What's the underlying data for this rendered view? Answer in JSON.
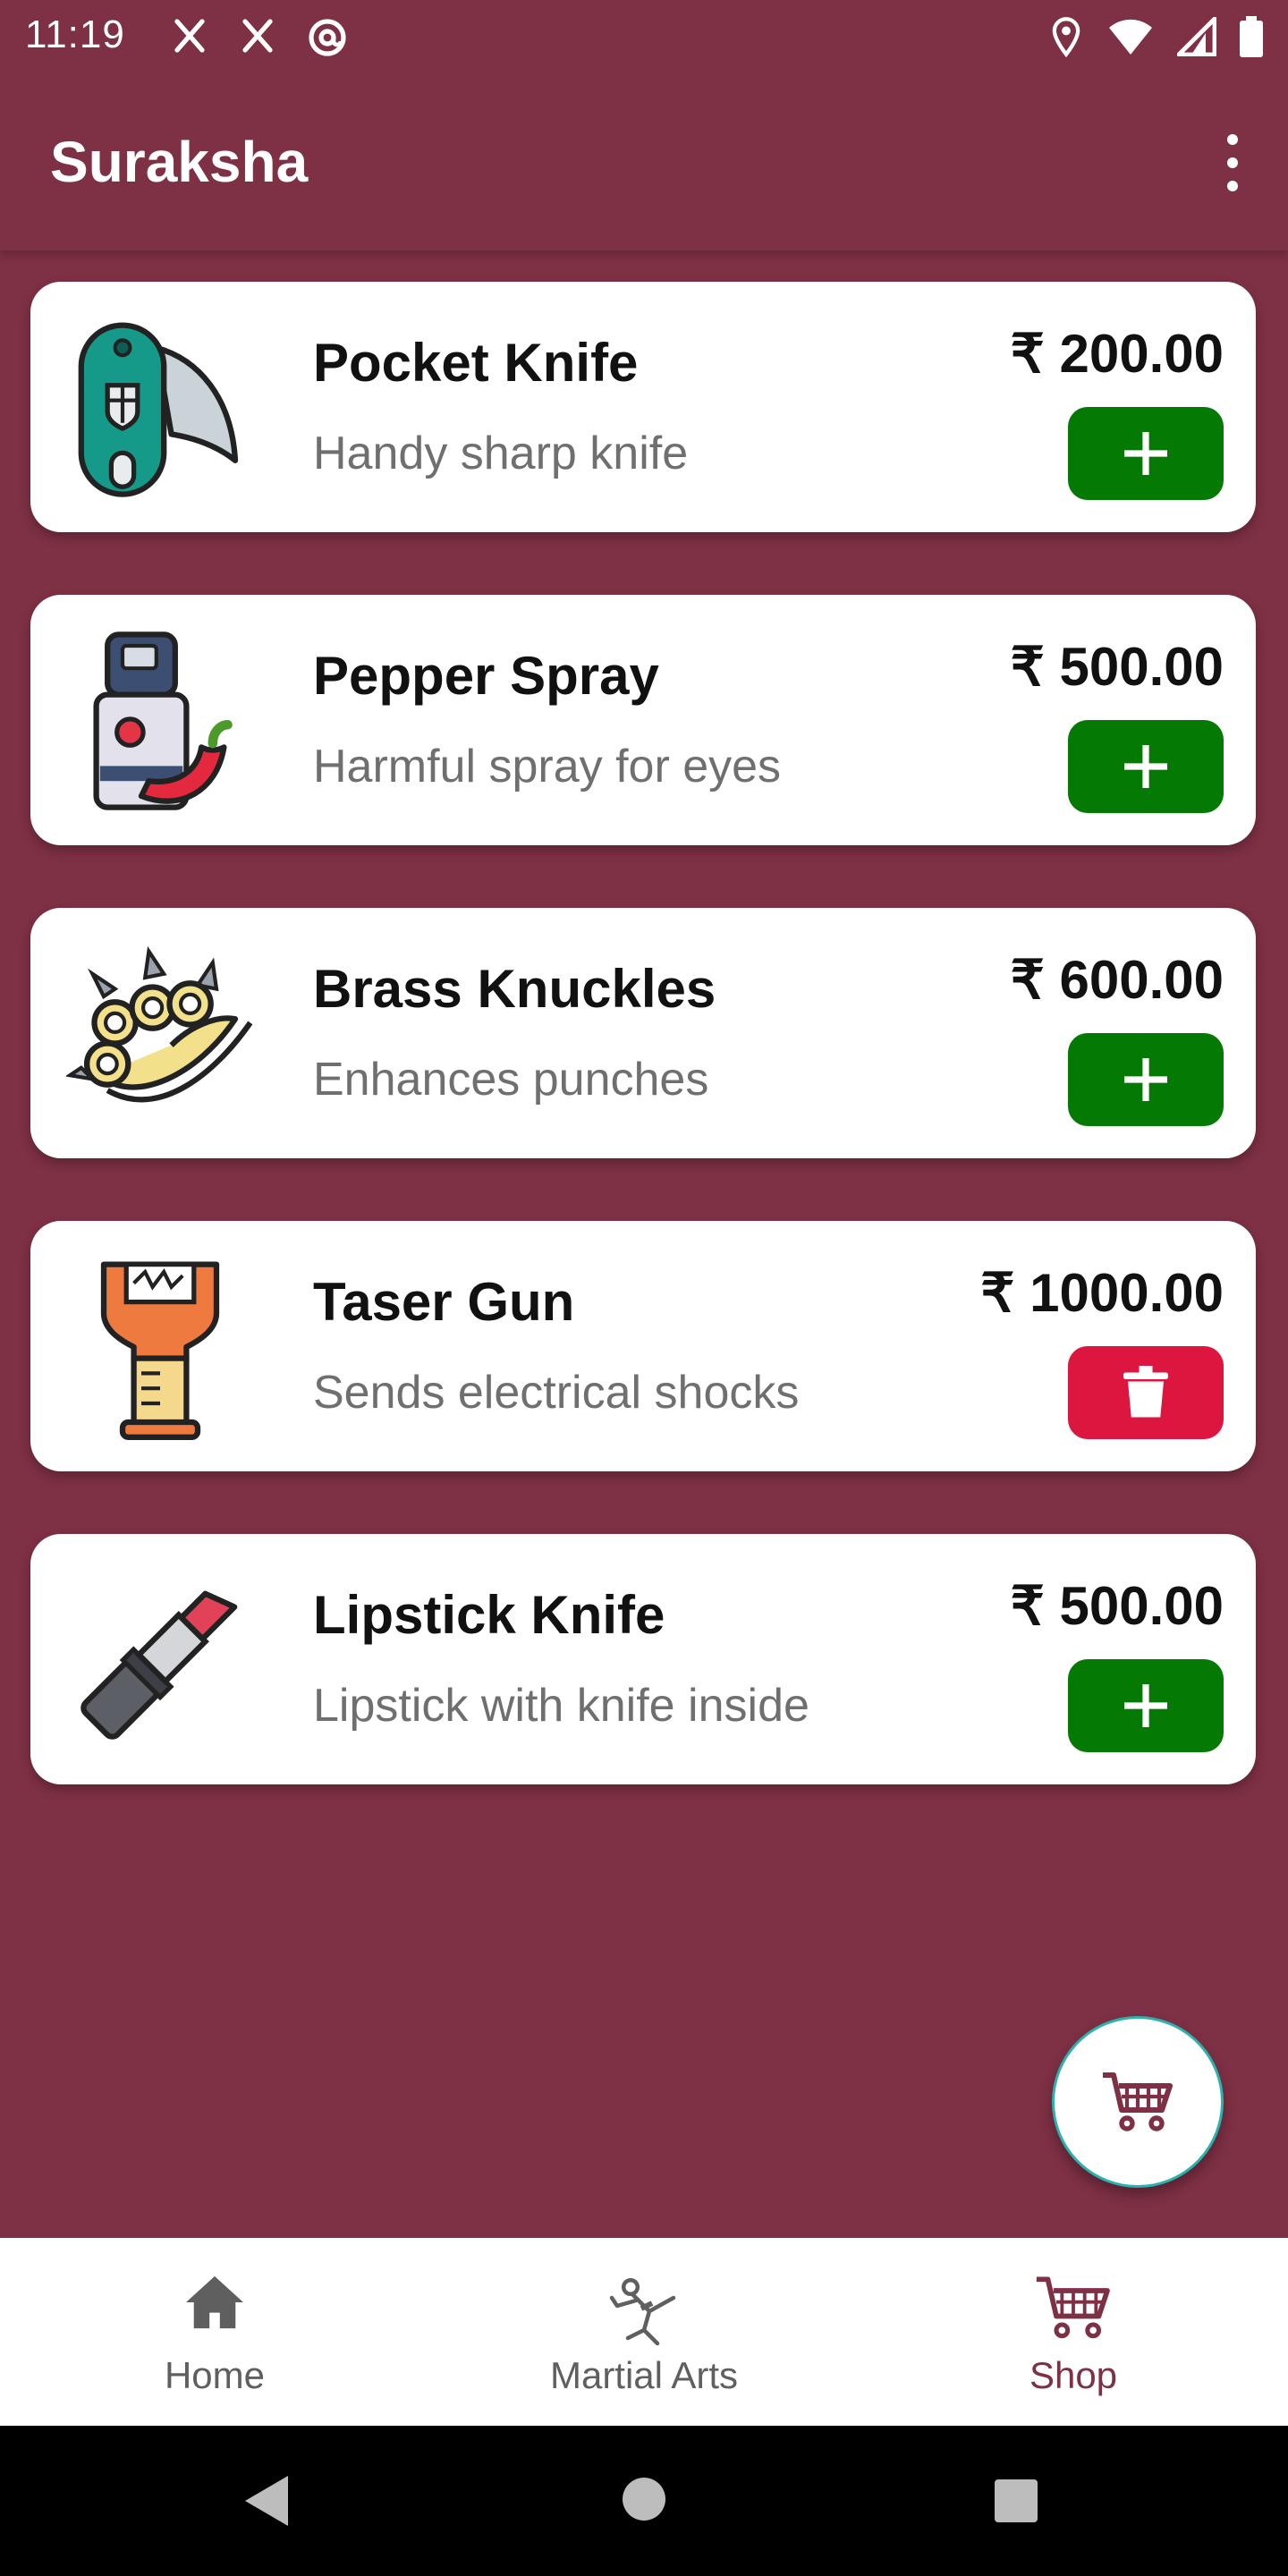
{
  "status_bar": {
    "time": "11:19"
  },
  "app_bar": {
    "title": "Suraksha"
  },
  "products": [
    {
      "name": "Pocket Knife",
      "description": "Handy sharp knife",
      "price": "₹ 200.00",
      "action": "add"
    },
    {
      "name": "Pepper Spray",
      "description": "Harmful spray for eyes",
      "price": "₹ 500.00",
      "action": "add"
    },
    {
      "name": "Brass Knuckles",
      "description": "Enhances punches",
      "price": "₹ 600.00",
      "action": "add"
    },
    {
      "name": "Taser Gun",
      "description": "Sends electrical shocks",
      "price": "₹ 1000.00",
      "action": "delete"
    },
    {
      "name": "Lipstick Knife",
      "description": "Lipstick with knife inside",
      "price": "₹ 500.00",
      "action": "add"
    }
  ],
  "bottom_nav": {
    "items": [
      {
        "label": "Home",
        "icon": "home-icon",
        "active": false
      },
      {
        "label": "Martial Arts",
        "icon": "martial-arts-icon",
        "active": false
      },
      {
        "label": "Shop",
        "icon": "cart-icon",
        "active": true
      }
    ]
  },
  "colors": {
    "background": "#7e3044",
    "add_button": "#047a05",
    "delete_button": "#dd1640",
    "nav_active": "#7e3044",
    "nav_inactive": "#5f5f5f",
    "fab_border": "#2bb2b0"
  }
}
